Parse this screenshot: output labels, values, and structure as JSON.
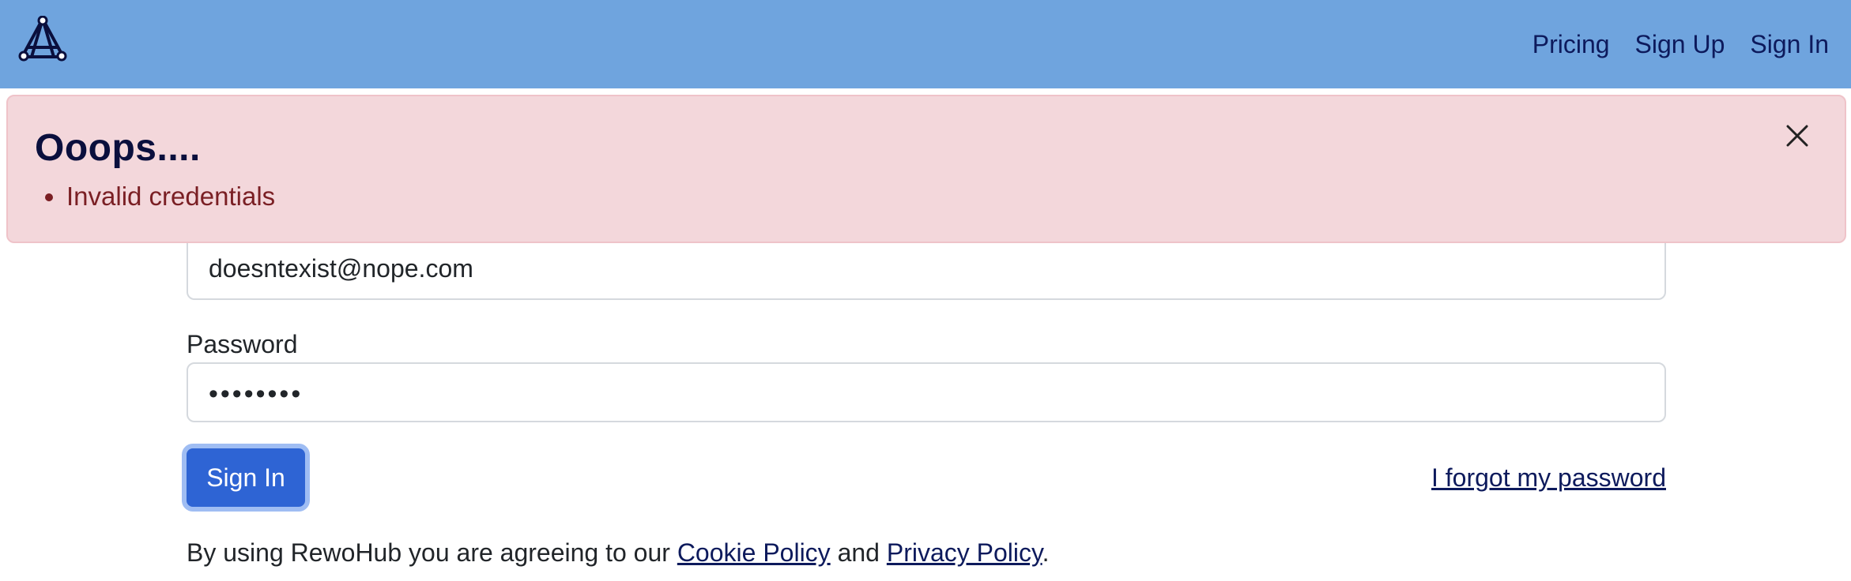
{
  "navbar": {
    "logo_icon": "triangle-logo-icon",
    "links": [
      "Pricing",
      "Sign Up",
      "Sign In"
    ],
    "background": "#6fa4de"
  },
  "alert": {
    "title": "Ooops....",
    "errors": [
      "Invalid credentials"
    ],
    "close_icon": "close-icon",
    "background": "#f3d7db",
    "text_color": "#7a1f24"
  },
  "form": {
    "email_value": "doesntexist@nope.com",
    "password_label": "Password",
    "password_value": "••••••••",
    "submit_label": "Sign In",
    "forgot_label": "I forgot my password",
    "button_color": "#2e64d4"
  },
  "footer": {
    "prefix": "By using RewoHub you are agreeing to our ",
    "cookie_link": "Cookie Policy",
    "middle": " and ",
    "privacy_link": "Privacy Policy",
    "suffix": "."
  }
}
